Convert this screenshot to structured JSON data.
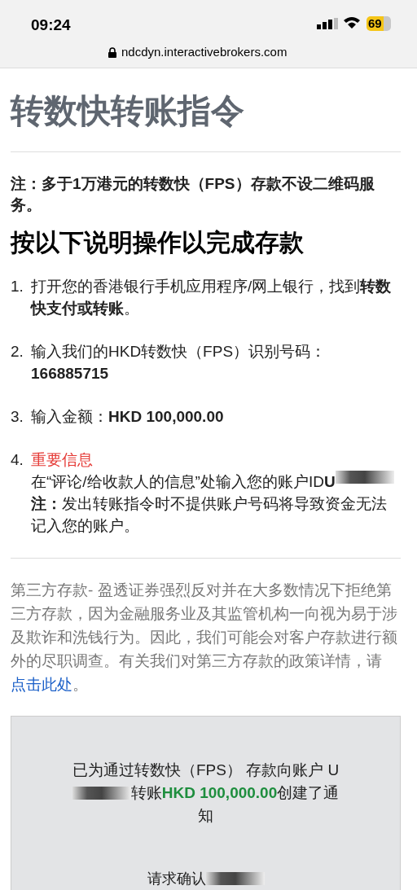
{
  "status_bar": {
    "time": "09:24",
    "battery": "69"
  },
  "address_bar": {
    "url": "ndcdyn.interactivebrokers.com"
  },
  "title": "转数快转账指令",
  "notice": "**注：多于1万港元的转数快（FPS）存款不设二维码服务。**",
  "heading": "按以下说明操作以完成存款",
  "steps": [
    {
      "number": "1.",
      "kind": "text",
      "text": "打开您的香港银行手机应用程序/网上银行，找到**转数快支付或转账**。"
    },
    {
      "number": "2.",
      "kind": "text",
      "text": "输入我们的HKD转数快（FPS）识别号码：**166885715**"
    },
    {
      "number": "3.",
      "kind": "text",
      "text": "输入金额：**HKD 100,000.00**"
    },
    {
      "number": "4.",
      "kind": "account",
      "important": "重要信息",
      "text": "在“评论/给收款人的信息”处输入您的账户ID**U**",
      "note": "**注：**发出转账指令时不提供账户号码将导致资金无法记入您的账户。"
    }
  ],
  "third_party": {
    "text": "第三方存款- 盈透证券强烈反对并在大多数情况下拒绝第三方存款，因为金融服务业及其监管机构一向视为易于涉及欺诈和洗钱行为。因此，我们可能会对客户存款进行额外的尽职调查。有关我们对第三方存款的政策详情，请",
    "link": "点击此处",
    "end": "。"
  },
  "confirmation": {
    "before": "已为通过转数快（FPS） 存款向账户 U",
    "middle": "转账",
    "amount": "HKD 100,000.00",
    "after": "创建了通知",
    "request": "请求确认"
  }
}
